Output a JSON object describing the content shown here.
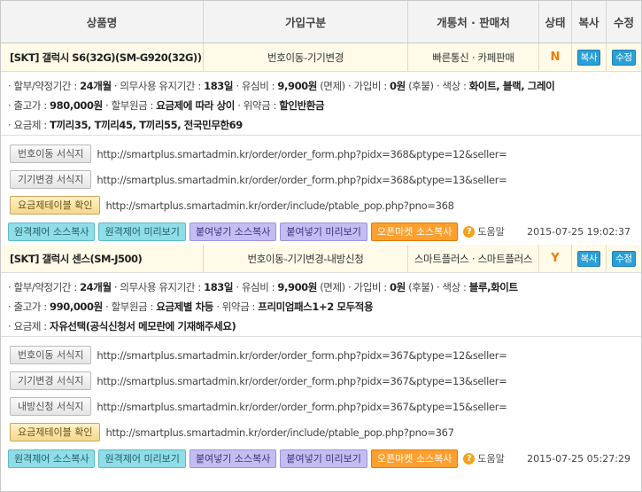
{
  "header": {
    "product": "상품명",
    "join_type": "가입구분",
    "store": "개통처 · 판매처",
    "status": "상태",
    "copy": "복사",
    "edit": "수정"
  },
  "products": [
    {
      "name": "[SKT] 갤럭시 S6(32G)(SM-G920(32G))",
      "join": "번호이동-기기변경",
      "store": "빠른통신 · 카페판매",
      "status": "N",
      "copy_label": "복사",
      "edit_label": "수정",
      "info": [
        [
          "· 할부/약정기간 : ",
          "24개월",
          " · 의무사용 유지기간 : ",
          "183일",
          " · 유심비 : ",
          "9,900원",
          " (면제) · 가입비 : ",
          "0원",
          " (후불) · 색상 : ",
          "화이트, 블랙, 그레이"
        ],
        [
          "· 출고가 : ",
          "980,000원",
          " · 할부원금 : ",
          "요금제에 따라 상이",
          " · 위약금 : ",
          "할인반환금"
        ],
        [
          "· 요금제 : ",
          "T끼리35, T끼리45, T끼리55, 전국민무한69"
        ]
      ],
      "links": [
        {
          "label": "번호이동 서식지",
          "url": "http://smartplus.smartadmin.kr/order/order_form.php?pidx=368&ptype=12&seller=",
          "style": "gray"
        },
        {
          "label": "기기변경 서식지",
          "url": "http://smartplus.smartadmin.kr/order/order_form.php?pidx=368&ptype=13&seller=",
          "style": "gray"
        },
        {
          "label": "요금제테이블 확인",
          "url": "http://smartplus.smartadmin.kr/order/include/ptable_pop.php?pno=368",
          "style": "yellow"
        }
      ],
      "actions": [
        "원격제어 소스복사",
        "원격제어 미리보기",
        "붙여넣기 소스복사",
        "붙여넣기 미리보기",
        "오픈마켓 소스복사"
      ],
      "help": "도움말",
      "date": "2015-07-25 19:02:37"
    },
    {
      "name": "[SKT] 갤럭시 센스(SM-J500)",
      "join": "번호이동-기기변경-내방신청",
      "store": "스마트플러스 · 스마트플러스",
      "status": "Y",
      "copy_label": "복사",
      "edit_label": "수정",
      "info": [
        [
          "· 할부/약정기간 : ",
          "24개월",
          " · 의무사용 유지기간 : ",
          "183일",
          " · 유심비 : ",
          "9,900원",
          " (면제) · 가입비 : ",
          "0원",
          " (후불) · 색상 : ",
          "블루,화이트"
        ],
        [
          "· 출고가 : ",
          "990,000원",
          " · 할부원금 : ",
          "요금제별 차등",
          " · 위약금 : ",
          "프리미엄패스1+2 모두적용"
        ],
        [
          "· 요금제 : ",
          "자유선택(공식신청서 메모란에 기재해주세요)"
        ]
      ],
      "links": [
        {
          "label": "번호이동 서식지",
          "url": "http://smartplus.smartadmin.kr/order/order_form.php?pidx=367&ptype=12&seller=",
          "style": "gray"
        },
        {
          "label": "기기변경 서식지",
          "url": "http://smartplus.smartadmin.kr/order/order_form.php?pidx=367&ptype=13&seller=",
          "style": "gray"
        },
        {
          "label": "내방신청 서식지",
          "url": "http://smartplus.smartadmin.kr/order/order_form.php?pidx=367&ptype=15&seller=",
          "style": "gray"
        },
        {
          "label": "요금제테이블 확인",
          "url": "http://smartplus.smartadmin.kr/order/include/ptable_pop.php?pno=367",
          "style": "yellow"
        }
      ],
      "actions": [
        "원격제어 소스복사",
        "원격제어 미리보기",
        "붙여넣기 소스복사",
        "붙여넣기 미리보기",
        "오픈마켓 소스복사"
      ],
      "help": "도움말",
      "date": "2015-07-25 05:27:29"
    }
  ],
  "colors": {
    "status_accent": "#f07c00",
    "blue_button": "#2a9fd8",
    "teal_button": "#8fdde6",
    "lavender_button": "#c4bdf2",
    "orange_button": "#ff9f2e"
  }
}
